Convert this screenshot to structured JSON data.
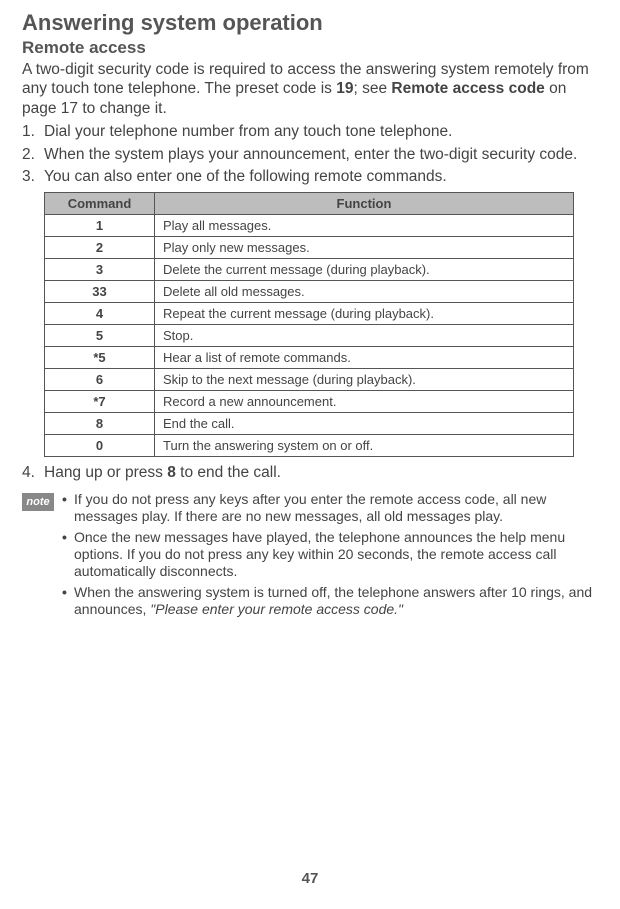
{
  "heading": "Answering system operation",
  "subheading": "Remote access",
  "intro_parts": {
    "p1": "A two-digit security code is required to access the answering system remotely from any touch tone telephone. The preset code is ",
    "code": "19",
    "p2": "; see ",
    "bold2": "Remote access code",
    "p3": " on page 17 to change it."
  },
  "steps": [
    "Dial your telephone number from any touch tone telephone.",
    "When the system plays your announcement, enter the two-digit security code.",
    "You can also enter one of the following remote commands."
  ],
  "table": {
    "head_cmd": "Command",
    "head_fn": "Function",
    "rows": [
      {
        "cmd": "1",
        "fn": "Play all messages."
      },
      {
        "cmd": "2",
        "fn": "Play only new messages."
      },
      {
        "cmd": "3",
        "fn": "Delete the current message (during playback)."
      },
      {
        "cmd": "33",
        "fn": "Delete all old messages."
      },
      {
        "cmd": "4",
        "fn": "Repeat the current message (during playback)."
      },
      {
        "cmd": "5",
        "fn": "Stop."
      },
      {
        "cmd": "*5",
        "fn": "Hear a list of remote commands."
      },
      {
        "cmd": "6",
        "fn": "Skip to the next message (during playback)."
      },
      {
        "cmd": "*7",
        "fn": "Record a new announcement."
      },
      {
        "cmd": "8",
        "fn": "End the call."
      },
      {
        "cmd": "0",
        "fn": "Turn the answering system on or off."
      }
    ]
  },
  "step4": {
    "p1": "Hang up or press ",
    "bold": "8",
    "p2": " to end the call."
  },
  "note": {
    "badge": "note",
    "items": [
      {
        "text": "If you do not press any keys after you enter the remote access code, all new messages play. If there are no new messages, all old messages play.",
        "italic": ""
      },
      {
        "text": "Once the new messages have played, the telephone announces the help menu options. If you do not press any key within 20 seconds, the remote access call automatically disconnects.",
        "italic": ""
      },
      {
        "text": "When the answering system is turned off, the telephone answers after 10 rings, and announces, ",
        "italic": "\"Please enter your remote access code.\""
      }
    ]
  },
  "page_number": "47"
}
